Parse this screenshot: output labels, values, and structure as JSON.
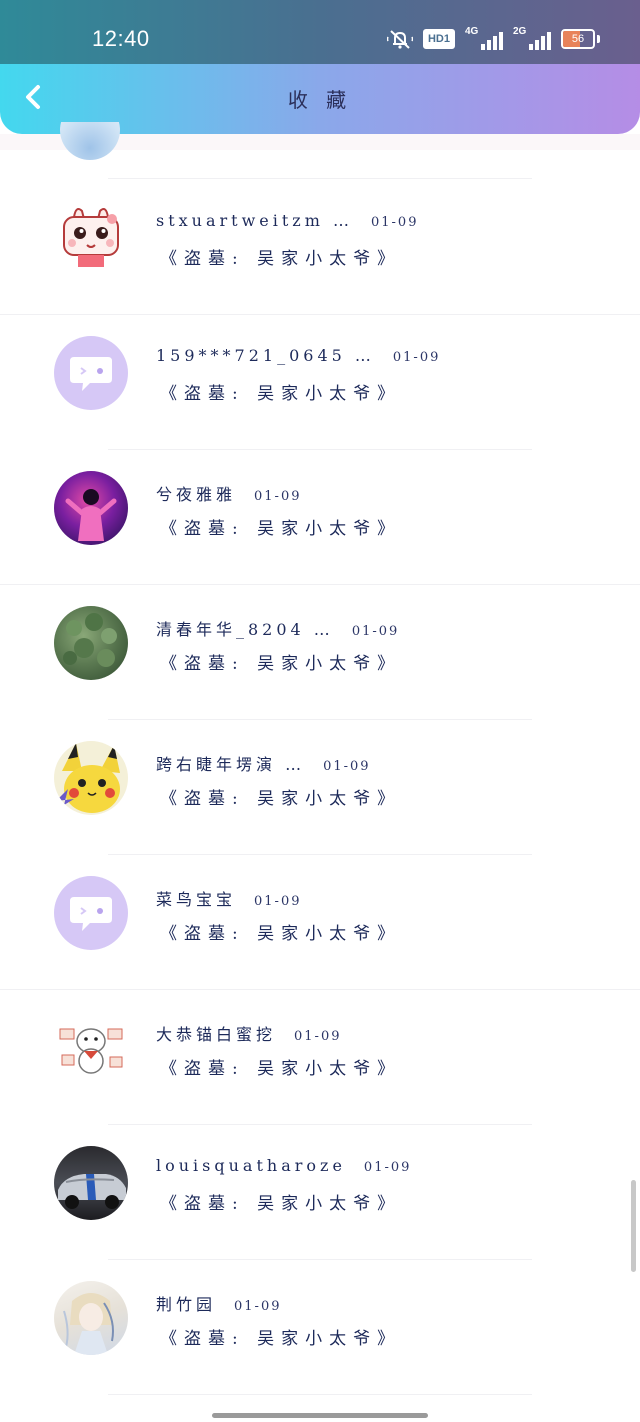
{
  "status_bar": {
    "time": "12:40",
    "hd_label": "HD1",
    "network_1": "4G",
    "network_2": "2G",
    "battery_level": "56",
    "battery_percent": 56
  },
  "header": {
    "title": "收 藏",
    "back_icon": "chevron-left-icon"
  },
  "colors": {
    "header_gradient_start": "#43d8ee",
    "header_gradient_end": "#b58de6",
    "text_primary": "#1d2a5a",
    "bubble_avatar_bg": "#d6c8f6"
  },
  "favorites": [
    {
      "name": "stxuartweitzm …",
      "date": "01-09",
      "subtitle": "《盗墓: 吴家小太爷》",
      "avatar": "cartoon-bunny-avatar"
    },
    {
      "name": "159***721_0645 …",
      "date": "01-09",
      "subtitle": "《盗墓: 吴家小太爷》",
      "avatar": "default-chat-bubble-avatar"
    },
    {
      "name": "兮夜雅雅",
      "date": "01-09",
      "subtitle": "《盗墓: 吴家小太爷》",
      "avatar": "singer-photo-avatar"
    },
    {
      "name": "清春年华_8204 …",
      "date": "01-09",
      "subtitle": "《盗墓: 吴家小太爷》",
      "avatar": "plant-photo-avatar"
    },
    {
      "name": "跨右睫年塄演 …",
      "date": "01-09",
      "subtitle": "《盗墓: 吴家小太爷》",
      "avatar": "pikachu-avatar"
    },
    {
      "name": "菜鸟宝宝",
      "date": "01-09",
      "subtitle": "《盗墓: 吴家小太爷》",
      "avatar": "default-chat-bubble-avatar"
    },
    {
      "name": "大恭锚白蜜挖",
      "date": "01-09",
      "subtitle": "《盗墓: 吴家小太爷》",
      "avatar": "cartoon-dog-avatar"
    },
    {
      "name": "louisquatharoze",
      "date": "01-09",
      "subtitle": "《盗墓: 吴家小太爷》",
      "avatar": "car-photo-avatar"
    },
    {
      "name": "荆竹园",
      "date": "01-09",
      "subtitle": "《盗墓: 吴家小太爷》",
      "avatar": "anime-character-avatar"
    }
  ]
}
